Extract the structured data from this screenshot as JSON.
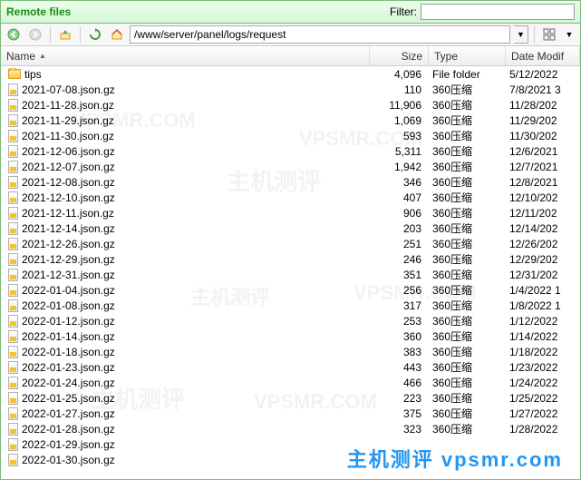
{
  "title": "Remote files",
  "filter": {
    "label": "Filter:",
    "value": ""
  },
  "toolbar": {
    "path": "/www/server/panel/logs/request"
  },
  "columns": {
    "name": "Name",
    "size": "Size",
    "type": "Type",
    "date": "Date Modif"
  },
  "typeFolder": "File folder",
  "typeGz": "360压缩",
  "files": [
    {
      "icon": "folder",
      "name": "tips",
      "size": "4,096",
      "type": "File folder",
      "date": "5/12/2022"
    },
    {
      "icon": "gz",
      "name": "2021-07-08.json.gz",
      "size": "110",
      "type": "360压缩",
      "date": "7/8/2021 3"
    },
    {
      "icon": "gz",
      "name": "2021-11-28.json.gz",
      "size": "11,906",
      "type": "360压缩",
      "date": "11/28/202"
    },
    {
      "icon": "gz",
      "name": "2021-11-29.json.gz",
      "size": "1,069",
      "type": "360压缩",
      "date": "11/29/202"
    },
    {
      "icon": "gz",
      "name": "2021-11-30.json.gz",
      "size": "593",
      "type": "360压缩",
      "date": "11/30/202"
    },
    {
      "icon": "gz",
      "name": "2021-12-06.json.gz",
      "size": "5,311",
      "type": "360压缩",
      "date": "12/6/2021"
    },
    {
      "icon": "gz",
      "name": "2021-12-07.json.gz",
      "size": "1,942",
      "type": "360压缩",
      "date": "12/7/2021"
    },
    {
      "icon": "gz",
      "name": "2021-12-08.json.gz",
      "size": "346",
      "type": "360压缩",
      "date": "12/8/2021"
    },
    {
      "icon": "gz",
      "name": "2021-12-10.json.gz",
      "size": "407",
      "type": "360压缩",
      "date": "12/10/202"
    },
    {
      "icon": "gz",
      "name": "2021-12-11.json.gz",
      "size": "906",
      "type": "360压缩",
      "date": "12/11/202"
    },
    {
      "icon": "gz",
      "name": "2021-12-14.json.gz",
      "size": "203",
      "type": "360压缩",
      "date": "12/14/202"
    },
    {
      "icon": "gz",
      "name": "2021-12-26.json.gz",
      "size": "251",
      "type": "360压缩",
      "date": "12/26/202"
    },
    {
      "icon": "gz",
      "name": "2021-12-29.json.gz",
      "size": "246",
      "type": "360压缩",
      "date": "12/29/202"
    },
    {
      "icon": "gz",
      "name": "2021-12-31.json.gz",
      "size": "351",
      "type": "360压缩",
      "date": "12/31/202"
    },
    {
      "icon": "gz",
      "name": "2022-01-04.json.gz",
      "size": "256",
      "type": "360压缩",
      "date": "1/4/2022 1"
    },
    {
      "icon": "gz",
      "name": "2022-01-08.json.gz",
      "size": "317",
      "type": "360压缩",
      "date": "1/8/2022 1"
    },
    {
      "icon": "gz",
      "name": "2022-01-12.json.gz",
      "size": "253",
      "type": "360压缩",
      "date": "1/12/2022"
    },
    {
      "icon": "gz",
      "name": "2022-01-14.json.gz",
      "size": "360",
      "type": "360压缩",
      "date": "1/14/2022"
    },
    {
      "icon": "gz",
      "name": "2022-01-18.json.gz",
      "size": "383",
      "type": "360压缩",
      "date": "1/18/2022"
    },
    {
      "icon": "gz",
      "name": "2022-01-23.json.gz",
      "size": "443",
      "type": "360压缩",
      "date": "1/23/2022"
    },
    {
      "icon": "gz",
      "name": "2022-01-24.json.gz",
      "size": "466",
      "type": "360压缩",
      "date": "1/24/2022"
    },
    {
      "icon": "gz",
      "name": "2022-01-25.json.gz",
      "size": "223",
      "type": "360压缩",
      "date": "1/25/2022"
    },
    {
      "icon": "gz",
      "name": "2022-01-27.json.gz",
      "size": "375",
      "type": "360压缩",
      "date": "1/27/2022"
    },
    {
      "icon": "gz",
      "name": "2022-01-28.json.gz",
      "size": "323",
      "type": "360压缩",
      "date": "1/28/2022"
    },
    {
      "icon": "gz",
      "name": "2022-01-29.json.gz",
      "size": "",
      "type": "",
      "date": ""
    },
    {
      "icon": "gz",
      "name": "2022-01-30.json.gz",
      "size": "",
      "type": "",
      "date": ""
    }
  ],
  "watermarks": {
    "en": "VPSMR.COM",
    "zh": "主机测评",
    "footer": "主机测评 vpsmr.com"
  }
}
